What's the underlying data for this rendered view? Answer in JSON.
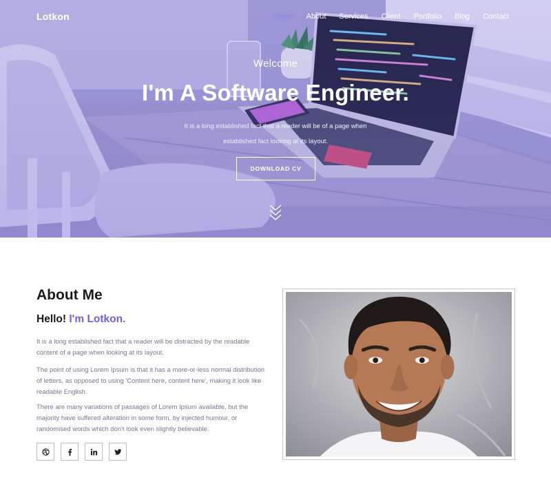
{
  "brand": "Lotkon",
  "nav": {
    "items": [
      {
        "label": "Home",
        "active": true
      },
      {
        "label": "About",
        "active": false
      },
      {
        "label": "Services",
        "active": false
      },
      {
        "label": "Client",
        "active": false
      },
      {
        "label": "Portfolio",
        "active": false
      },
      {
        "label": "Blog",
        "active": false
      },
      {
        "label": "Contact",
        "active": false
      }
    ]
  },
  "hero": {
    "welcome": "Welcome",
    "title_prefix": "I'm",
    "title_main": "A Software Engineer.",
    "description": "It is a long established fact that a reader will be of a page when established fact looking at its layout.",
    "cv_button": "DOWNLOAD CV",
    "scroll_icon": "double-chevron-down-icon"
  },
  "about": {
    "heading_bold": "About",
    "heading_rest": "Me",
    "hello": "Hello!",
    "name": "I'm Lotkon.",
    "paragraphs": [
      "It is a long established fact that a reader will be distracted by the readable content of a page when looking at its layout.",
      "The point of using Lorem Ipsum is that it has a more-or-less normal distribution of letters, as opposed to using 'Content here, content here', making it look like readable English.",
      "There are many variations of passages of Lorem Ipsum available, but the majority have suffered alteration in some form, by injected humour, or randomised words which don't look even slightly believable."
    ],
    "socials": [
      "dribbble-icon",
      "facebook-icon",
      "linkedin-icon",
      "twitter-icon"
    ]
  },
  "colors": {
    "accent": "#6c63d9",
    "nav_active": "#8e86ea",
    "hero_overlay": "#7a70d6",
    "body_text": "#74788c"
  }
}
